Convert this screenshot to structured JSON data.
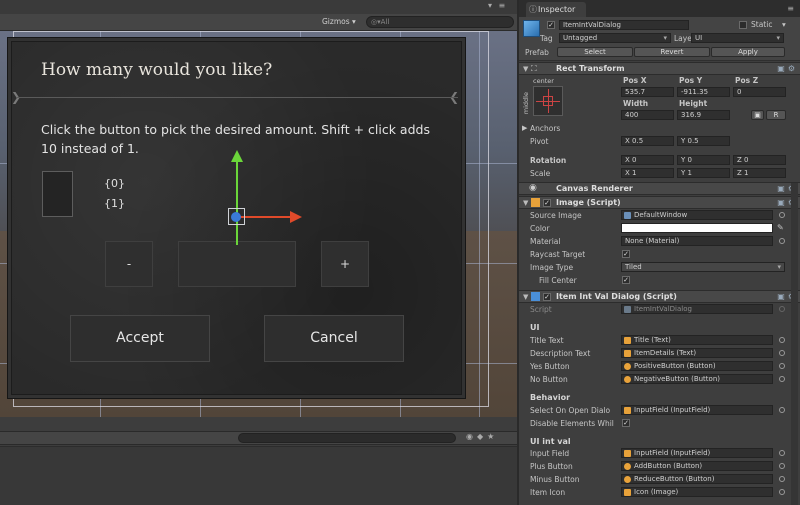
{
  "scene": {
    "toolbar": {
      "gizmos": "Gizmos ▾",
      "search_placeholder": "◎▾All",
      "window_controls": "▾ ≡"
    },
    "dialog": {
      "title": "How many would you like?",
      "description": "Click the button to pick the desired amount. Shift + click adds 10 instead of 1.",
      "format_line_1": "{0}",
      "format_line_2": "{1}",
      "minus_label": "-",
      "plus_label": "+",
      "accept_label": "Accept",
      "cancel_label": "Cancel"
    }
  },
  "inspector": {
    "tab_label": "Inspector",
    "menu_glyph": "≡",
    "object_name": "ItemIntValDialog",
    "static_label": "Static",
    "tag_label": "Tag",
    "tag_value": "Untagged",
    "layer_label": "Layer",
    "layer_value": "UI",
    "prefab_label": "Prefab",
    "prefab_select": "Select",
    "prefab_revert": "Revert",
    "prefab_apply": "Apply",
    "rect_transform": {
      "title": "Rect Transform",
      "anchor_h": "center",
      "anchor_v": "middle",
      "pos_x_label": "Pos X",
      "pos_y_label": "Pos Y",
      "pos_z_label": "Pos Z",
      "pos_x": "535.7",
      "pos_y": "-911.35",
      "pos_z": "0",
      "width_label": "Width",
      "height_label": "Height",
      "width": "400",
      "height": "316.9",
      "r_button": "R",
      "anchors_label": "Anchors",
      "pivot_label": "Pivot",
      "pivot_x": "X 0.5",
      "pivot_y": "Y 0.5",
      "rotation_label": "Rotation",
      "rot_x": "X 0",
      "rot_y": "Y 0",
      "rot_z": "Z 0",
      "scale_label": "Scale",
      "scale_x": "X 1",
      "scale_y": "Y 1",
      "scale_z": "Z 1"
    },
    "canvas_renderer": {
      "title": "Canvas Renderer"
    },
    "image": {
      "title": "Image (Script)",
      "source_image_label": "Source Image",
      "source_image": "DefaultWindow",
      "color_label": "Color",
      "material_label": "Material",
      "material": "None (Material)",
      "raycast_label": "Raycast Target",
      "image_type_label": "Image Type",
      "image_type": "Tiled",
      "fill_center_label": "Fill Center"
    },
    "dialog_script": {
      "title": "Item Int Val Dialog (Script)",
      "script_label": "Script",
      "script": "ItemIntValDialog",
      "ui_section": "UI",
      "title_text_label": "Title Text",
      "title_text": "Title (Text)",
      "desc_text_label": "Description Text",
      "desc_text": "ItemDetails (Text)",
      "yes_label": "Yes Button",
      "yes_value": "PositiveButton (Button)",
      "no_label": "No Button",
      "no_value": "NegativeButton (Button)",
      "behavior_section": "Behavior",
      "select_open_label": "Select On Open Dialo",
      "select_open_value": "InputField (InputField)",
      "disable_label": "Disable Elements Whil",
      "int_section": "UI int val",
      "input_label": "Input Field",
      "input_value": "InputField (InputField)",
      "plus_label": "Plus Button",
      "plus_value": "AddButton (Button)",
      "minus_label": "Minus Button",
      "minus_value": "ReduceButton (Button)",
      "icon_label": "Item Icon",
      "icon_value": "Icon (Image)"
    }
  },
  "colors": {
    "gizmo_y": "#6bd63a",
    "gizmo_x": "#e04a2a",
    "gizmo_center": "#3a7ad6",
    "script_icon": "#4a8fd8",
    "unity_obj_icon": "#e8a23a"
  }
}
